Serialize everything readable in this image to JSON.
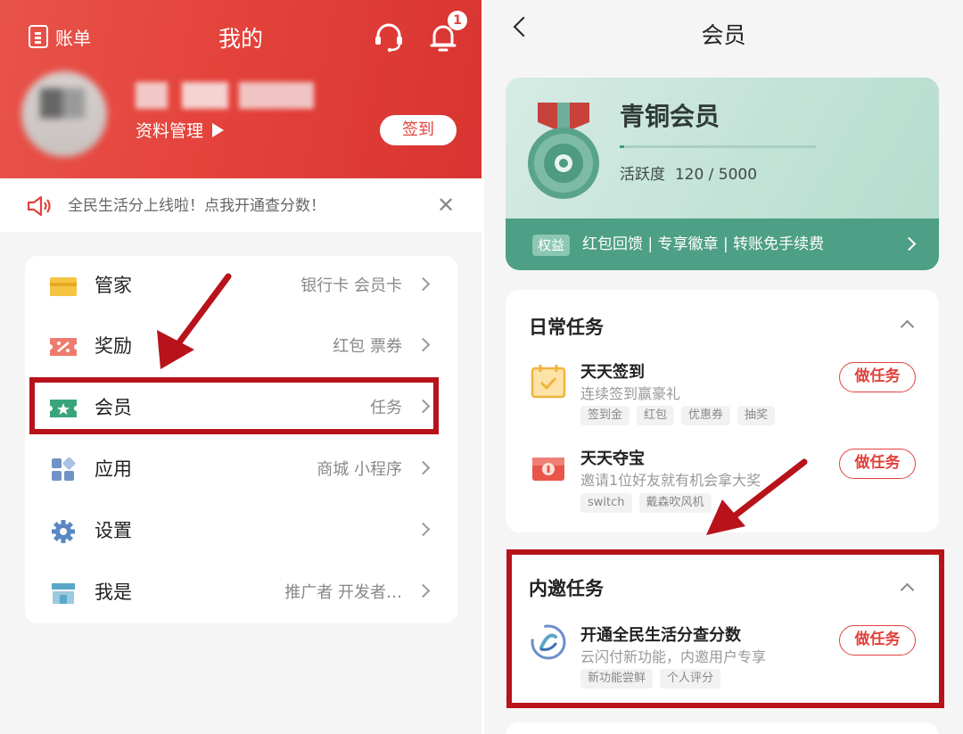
{
  "left": {
    "header": {
      "bill_label": "账单",
      "title": "我的",
      "notification_count": "1",
      "profile_manage_label": "资料管理",
      "signin_label": "签到"
    },
    "notice": {
      "text": "全民生活分上线啦！点我开通查分数！",
      "close_glyph": "✕"
    },
    "menu": [
      {
        "label": "管家",
        "sub": "银行卡 会员卡",
        "icon": "card-icon"
      },
      {
        "label": "奖励",
        "sub": "红包 票券",
        "icon": "ticket-icon"
      },
      {
        "label": "会员",
        "sub": "任务",
        "icon": "member-card-icon"
      },
      {
        "label": "应用",
        "sub": "商城 小程序",
        "icon": "apps-grid-icon"
      },
      {
        "label": "设置",
        "sub": "",
        "icon": "gear-icon"
      },
      {
        "label": "我是",
        "sub": "推广者 开发者…",
        "icon": "store-icon"
      }
    ]
  },
  "right": {
    "title": "会员",
    "member_card": {
      "tier": "青铜会员",
      "activity_label": "活跃度",
      "activity_value": "120 / 5000",
      "activity_progress": 0.024,
      "benefit_tag": "权益",
      "benefits": "红包回馈 | 专享徽章 | 转账免手续费"
    },
    "daily_tasks": {
      "title": "日常任务",
      "items": [
        {
          "title": "天天签到",
          "desc": "连续签到赢豪礼",
          "tags": [
            "签到金",
            "红包",
            "优惠券",
            "抽奖"
          ],
          "button": "做任务"
        },
        {
          "title": "天天夺宝",
          "desc": "邀请1位好友就有机会拿大奖",
          "tags": [
            "switch",
            "戴森吹风机"
          ],
          "button": "做任务"
        }
      ]
    },
    "invite_tasks": {
      "title": "内邀任务",
      "items": [
        {
          "title": "开通全民生活分查分数",
          "desc": "云闪付新功能，内邀用户专享",
          "tags": [
            "新功能尝鲜",
            "个人评分"
          ],
          "button": "做任务"
        }
      ]
    }
  },
  "colors": {
    "brand_red": "#e3413b",
    "annotation_red": "#b8121b",
    "member_green": "#4d9f85"
  }
}
